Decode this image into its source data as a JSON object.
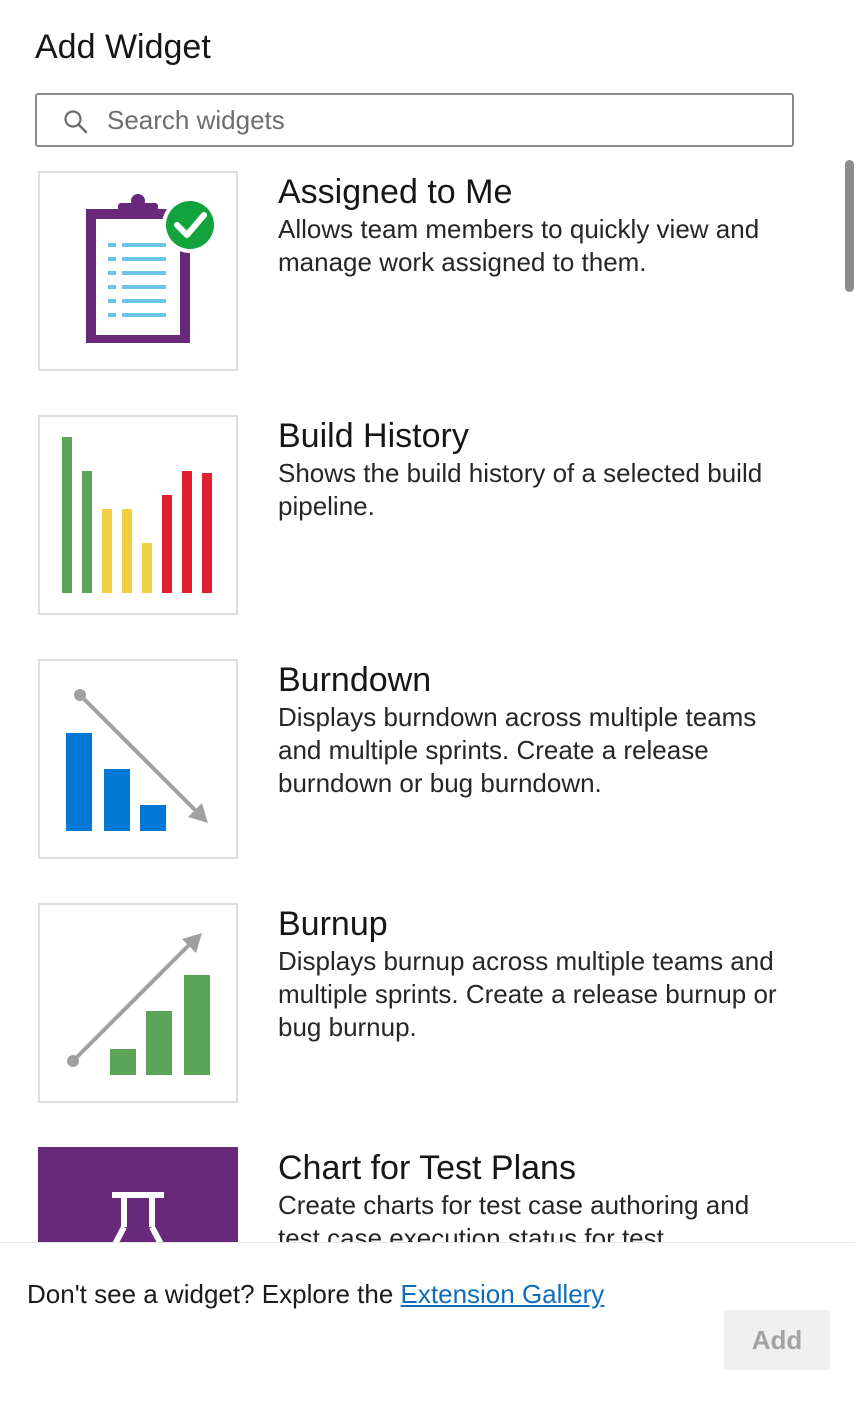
{
  "panel": {
    "title": "Add Widget"
  },
  "search": {
    "placeholder": "Search widgets",
    "icon": "search-icon"
  },
  "widgets": [
    {
      "title": "Assigned to Me",
      "description": "Allows team members to quickly view and manage work assigned to them.",
      "icon": "clipboard-check-icon"
    },
    {
      "title": "Build History",
      "description": "Shows the build history of a selected build pipeline.",
      "icon": "bar-history-icon"
    },
    {
      "title": "Burndown",
      "description": "Displays burndown across multiple teams and multiple sprints. Create a release burndown or bug burndown.",
      "icon": "burndown-chart-icon"
    },
    {
      "title": "Burnup",
      "description": "Displays burnup across multiple teams and multiple sprints. Create a release burnup or bug burnup.",
      "icon": "burnup-chart-icon"
    },
    {
      "title": "Chart for Test Plans",
      "description": "Create charts for test case authoring and test case execution status for test",
      "icon": "test-flask-icon"
    }
  ],
  "footer": {
    "text": "Don't see a widget? Explore the",
    "link_label": "Extension Gallery",
    "add_label": "Add"
  },
  "colors": {
    "accent": "#0f6cbd",
    "purple": "#68297a",
    "green": "#5ba55b",
    "yellow": "#f0cf45",
    "red": "#e0202e",
    "blue": "#0078d4",
    "grey": "#a0a0a0"
  }
}
